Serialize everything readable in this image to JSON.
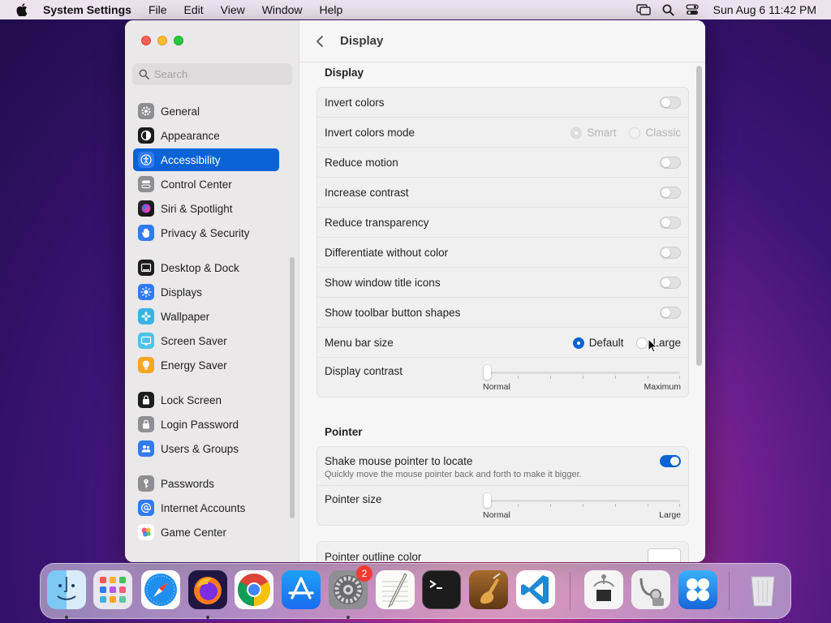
{
  "menubar": {
    "app_name": "System Settings",
    "items": [
      "File",
      "Edit",
      "View",
      "Window",
      "Help"
    ],
    "clock": "Sun Aug 6  11:42 PM"
  },
  "sidebar": {
    "search_placeholder": "Search",
    "items": [
      {
        "label": "General",
        "icon": "gear-icon",
        "color": "#8e8e93"
      },
      {
        "label": "Appearance",
        "icon": "appearance-icon",
        "color": "#1c1c1e"
      },
      {
        "label": "Accessibility",
        "icon": "accessibility-icon",
        "color": "#0a63d6",
        "active": true
      },
      {
        "label": "Control Center",
        "icon": "control-center-icon",
        "color": "#8e8e93"
      },
      {
        "label": "Siri & Spotlight",
        "icon": "siri-icon",
        "color": "#c03ed7"
      },
      {
        "label": "Privacy & Security",
        "icon": "hand-icon",
        "color": "#2f7bf6"
      },
      {
        "label": "Desktop & Dock",
        "icon": "dock-icon",
        "color": "#1c1c1e"
      },
      {
        "label": "Displays",
        "icon": "sun-icon",
        "color": "#2f7bf6"
      },
      {
        "label": "Wallpaper",
        "icon": "flower-icon",
        "color": "#39b3e6"
      },
      {
        "label": "Screen Saver",
        "icon": "screen-saver-icon",
        "color": "#4cc3e8"
      },
      {
        "label": "Energy Saver",
        "icon": "bulb-icon",
        "color": "#f6a623"
      },
      {
        "label": "Lock Screen",
        "icon": "lock-icon",
        "color": "#1c1c1e"
      },
      {
        "label": "Login Password",
        "icon": "lock-icon",
        "color": "#8e8e93"
      },
      {
        "label": "Users & Groups",
        "icon": "users-icon",
        "color": "#2f7bf6"
      },
      {
        "label": "Passwords",
        "icon": "key-icon",
        "color": "#8e8e93"
      },
      {
        "label": "Internet Accounts",
        "icon": "at-icon",
        "color": "#2f7bf6"
      },
      {
        "label": "Game Center",
        "icon": "game-center-icon",
        "color": "#f35c7a"
      }
    ]
  },
  "main": {
    "title": "Display",
    "display_section": {
      "title": "Display",
      "invert_colors": "Invert colors",
      "invert_colors_mode": "Invert colors mode",
      "invert_mode_options": [
        "Smart",
        "Classic"
      ],
      "reduce_motion": "Reduce motion",
      "increase_contrast": "Increase contrast",
      "reduce_transparency": "Reduce transparency",
      "differentiate_without_color": "Differentiate without color",
      "show_window_title_icons": "Show window title icons",
      "show_toolbar_button_shapes": "Show toolbar button shapes",
      "menu_bar_size": "Menu bar size",
      "menu_bar_options": [
        "Default",
        "Large"
      ],
      "display_contrast": "Display contrast",
      "contrast_min": "Normal",
      "contrast_max": "Maximum"
    },
    "pointer_section": {
      "title": "Pointer",
      "shake_to_locate": "Shake mouse pointer to locate",
      "shake_description": "Quickly move the mouse pointer back and forth to make it bigger.",
      "pointer_size": "Pointer size",
      "size_min": "Normal",
      "size_max": "Large",
      "outline_color": "Pointer outline color"
    }
  },
  "dock": {
    "apps": [
      "Finder",
      "Launchpad",
      "Safari",
      "Firefox",
      "Chrome",
      "App Store",
      "System Settings",
      "TextEdit",
      "Terminal",
      "Instruments",
      "VS Code",
      "System Information",
      "Disk Utility",
      "Unknown App",
      "Trash"
    ],
    "settings_badge": "2"
  }
}
